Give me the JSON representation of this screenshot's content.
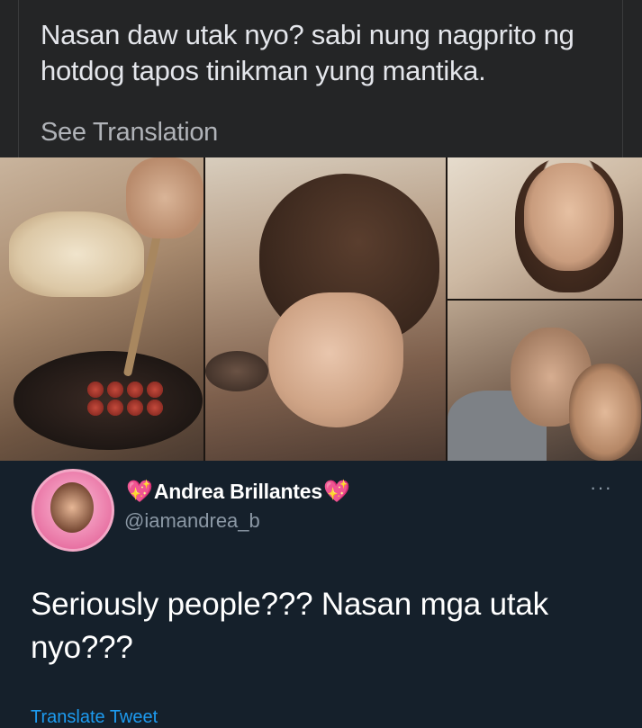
{
  "top_post": {
    "text": "Nasan daw utak nyo? sabi nung nagprito ng hotdog tapos tinikman yung mantika.",
    "see_translation": "See Translation"
  },
  "collage": {
    "panels": [
      "woman-frying-hotdogs",
      "woman-tasting-oil",
      "woman-smiling",
      "couple-cuddling"
    ]
  },
  "tweet": {
    "heart_left": "💖",
    "display_name": "Andrea Brillantes",
    "heart_right": "💖",
    "handle": "@iamandrea_b",
    "more_icon": "···",
    "text": "Seriously people??? Nasan mga utak nyo???",
    "translate_label": "Translate Tweet",
    "link_color": "#1d9bf0"
  }
}
